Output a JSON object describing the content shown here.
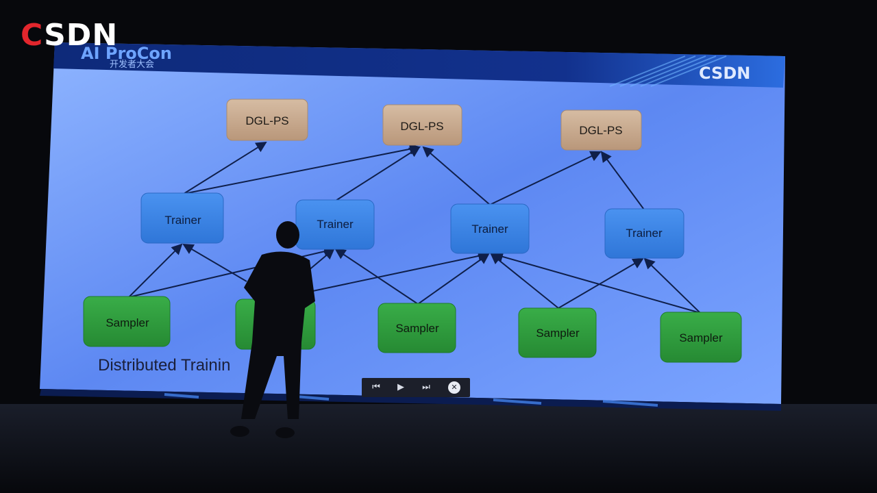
{
  "watermark": {
    "c_letter": "C",
    "rest": "SDN"
  },
  "slide": {
    "header_logo_primary": "AI ProCon",
    "header_logo_secondary": "开发者大会",
    "brand_right": "CSDN",
    "title": "Distributed Trainin",
    "diagram": {
      "ps_nodes": [
        "DGL-PS",
        "DGL-PS",
        "DGL-PS"
      ],
      "trainer_nodes": [
        "Trainer",
        "Trainer",
        "Trainer",
        "Trainer"
      ],
      "sampler_nodes": [
        "Sampler",
        "Sampler",
        "Sampler",
        "Sampler",
        "Sampler"
      ]
    }
  },
  "player_controls": {
    "prev": "⏮",
    "play": "▶",
    "next": "⏭",
    "close": "✕"
  },
  "colors": {
    "ps_fill": "#c9ab8e",
    "trainer_fill": "#3f86e6",
    "sampler_fill": "#2f9e3f",
    "screen_blue": "#4f7ff0",
    "control_bar": "#1c1f2a"
  }
}
